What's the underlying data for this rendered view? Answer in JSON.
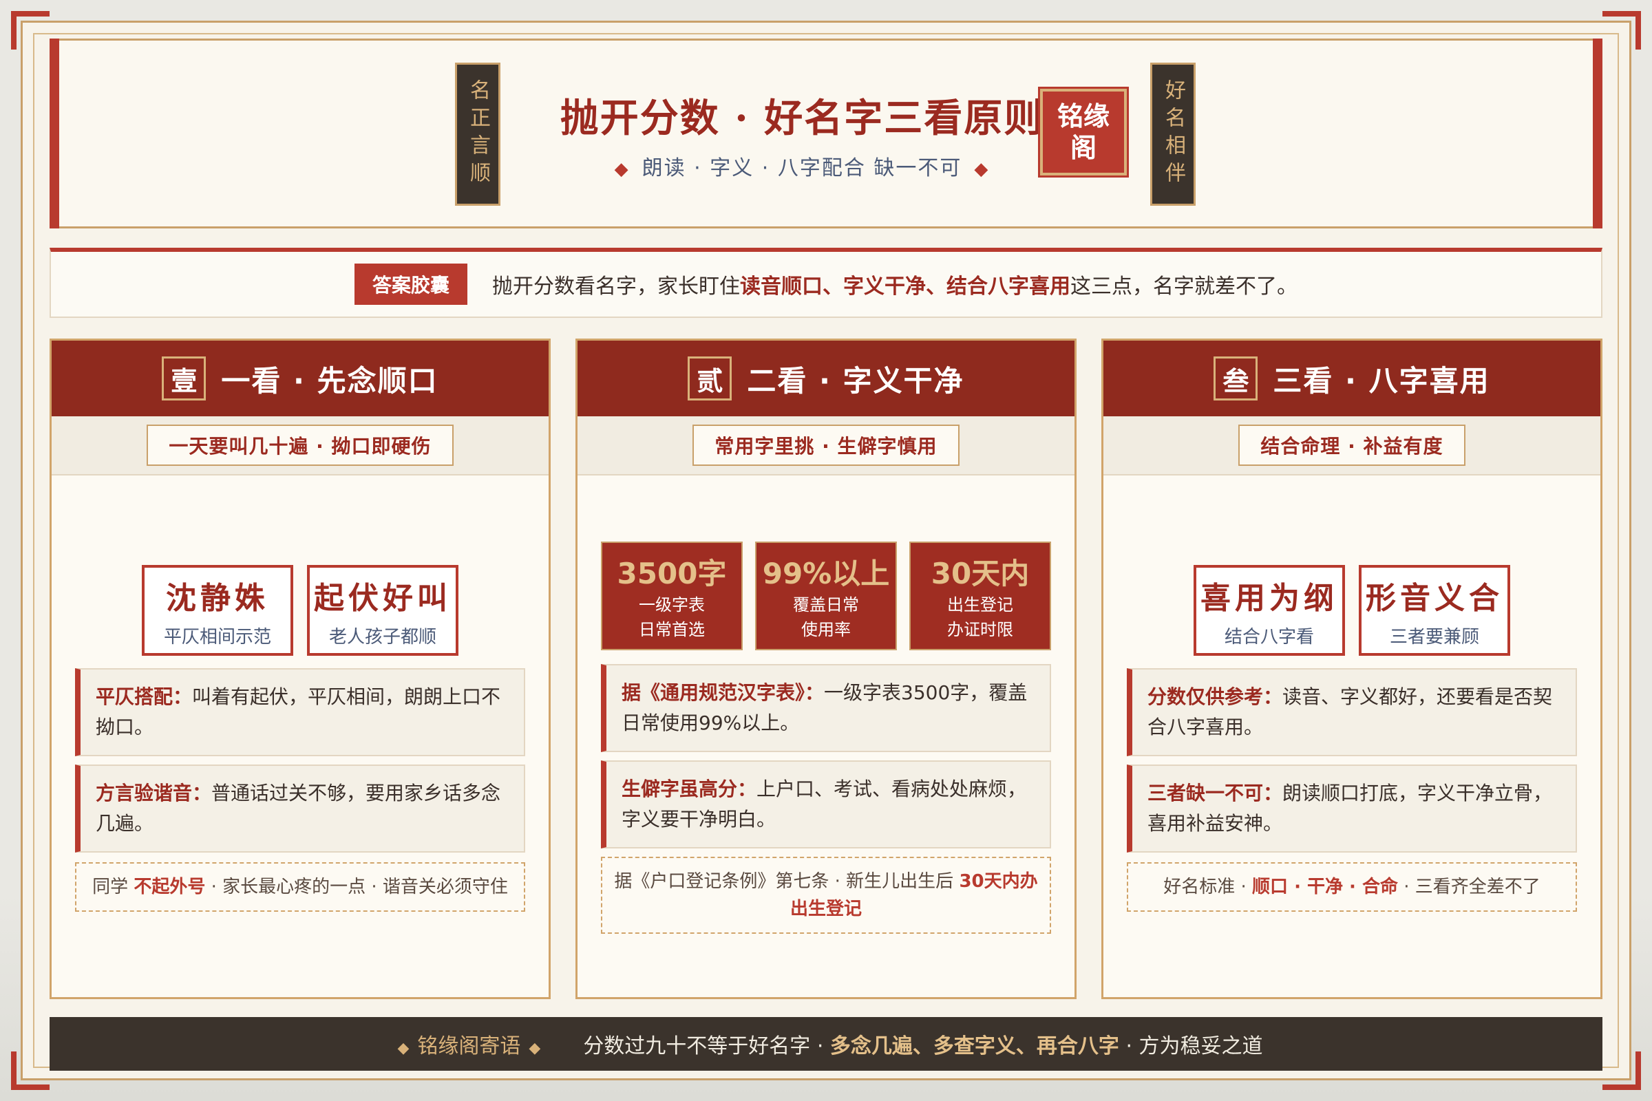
{
  "header": {
    "left_scroll": "名正言顺",
    "right_scroll": "好名相伴",
    "title": "抛开分数 · 好名字三看原则",
    "subtitle": "朗读 · 字义 · 八字配合 缺一不可",
    "seal": "铭缘阁"
  },
  "answer": {
    "tag": "答案胶囊",
    "prefix": "抛开分数看名字，家长盯住",
    "emphasis": "读音顺口、字义干净、结合八字喜用",
    "suffix": "这三点，名字就差不了。"
  },
  "columns": [
    {
      "num": "壹",
      "title": "一看 · 先念顺口",
      "tag": "一天要叫几十遍 · 拗口即硬伤",
      "cards": [
        {
          "big": "沈静姝",
          "small": "平仄相间示范"
        },
        {
          "big": "起伏好叫",
          "small": "老人孩子都顺"
        }
      ],
      "notes": [
        {
          "label": "平仄搭配：",
          "text": "叫着有起伏，平仄相间，朗朗上口不拗口。"
        },
        {
          "label": "方言验谐音：",
          "text": "普通话过关不够，要用家乡话多念几遍。"
        }
      ],
      "footnote": {
        "prefix": "同学 ",
        "em": "不起外号",
        "suffix": " · 家长最心疼的一点 · 谐音关必须守住"
      }
    },
    {
      "num": "贰",
      "title": "二看 · 字义干净",
      "tag": "常用字里挑 · 生僻字慎用",
      "stats": [
        {
          "num": "3500字",
          "line1": "一级字表",
          "line2": "日常首选"
        },
        {
          "num": "99%以上",
          "line1": "覆盖日常",
          "line2": "使用率"
        },
        {
          "num": "30天内",
          "line1": "出生登记",
          "line2": "办证时限"
        }
      ],
      "notes": [
        {
          "label": "据《通用规范汉字表》：",
          "text": "一级字表3500字，覆盖日常使用99%以上。"
        },
        {
          "label": "生僻字虽高分：",
          "text": "上户口、考试、看病处处麻烦，字义要干净明白。"
        }
      ],
      "footnote": {
        "prefix": "据《户口登记条例》第七条 · 新生儿出生后 ",
        "em": "30天内办出生登记",
        "suffix": ""
      }
    },
    {
      "num": "叁",
      "title": "三看 · 八字喜用",
      "tag": "结合命理 · 补益有度",
      "cards": [
        {
          "big": "喜用为纲",
          "small": "结合八字看"
        },
        {
          "big": "形音义合",
          "small": "三者要兼顾"
        }
      ],
      "notes": [
        {
          "label": "分数仅供参考：",
          "text": "读音、字义都好，还要看是否契合八字喜用。"
        },
        {
          "label": "三者缺一不可：",
          "text": "朗读顺口打底，字义干净立骨，喜用补益安神。"
        }
      ],
      "footnote": {
        "prefix": "好名标准 · ",
        "em": "顺口 · 干净 · 合命",
        "suffix": " · 三看齐全差不了"
      }
    }
  ],
  "footer": {
    "label": "铭缘阁寄语",
    "prefix": "分数过九十不等于好名字 · ",
    "em": "多念几遍、多查字义、再合八字",
    "suffix": " · 方为稳妥之道"
  },
  "colors": {
    "accent_red": "#b83a2e",
    "dark_red": "#8f2a1e",
    "gold": "#c9a06a",
    "dark_brown": "#3b332c",
    "paper": "#fdfaf3"
  }
}
